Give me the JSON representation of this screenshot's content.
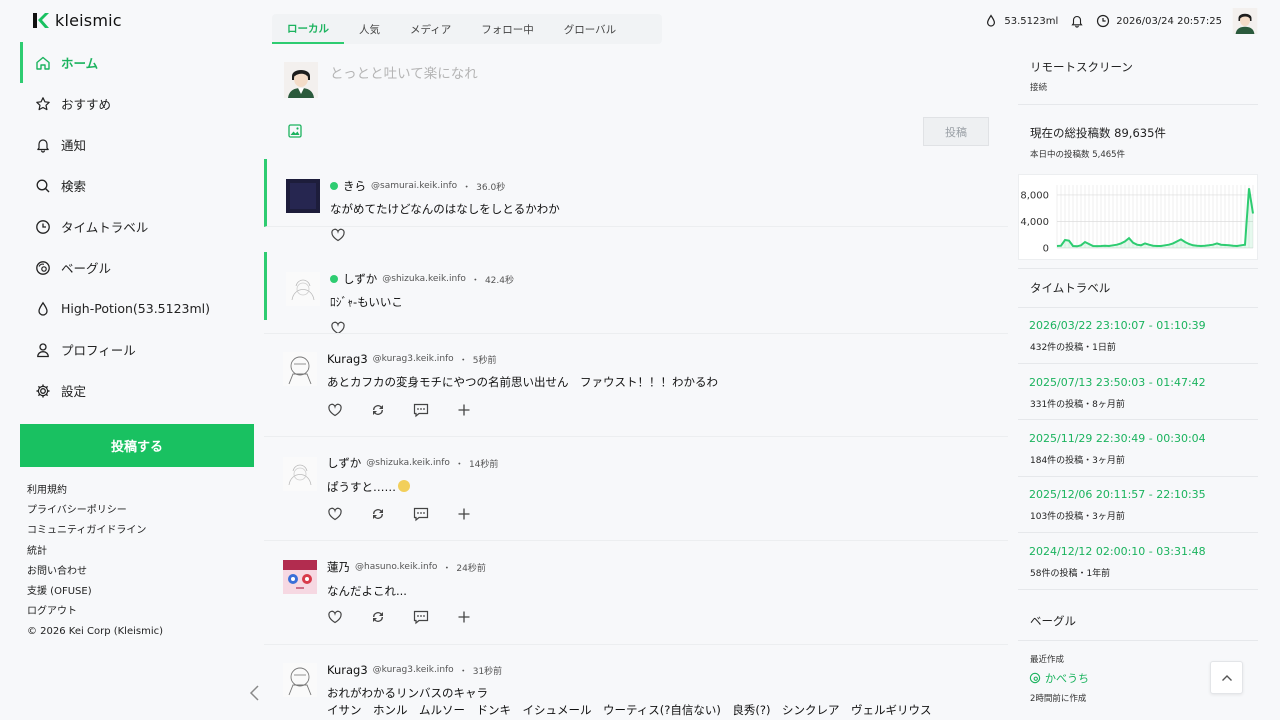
{
  "brand": {
    "name": "kleismic",
    "accent": "#19c161"
  },
  "nav": {
    "items": [
      {
        "label": "ホーム",
        "icon": "home-icon",
        "active": true
      },
      {
        "label": "おすすめ",
        "icon": "star-icon"
      },
      {
        "label": "通知",
        "icon": "bell-icon"
      },
      {
        "label": "検索",
        "icon": "search-icon"
      },
      {
        "label": "タイムトラベル",
        "icon": "clock-icon"
      },
      {
        "label": "ベーグル",
        "icon": "bagel-icon"
      },
      {
        "label": "High-Potion(53.5123ml)",
        "icon": "drop-icon"
      },
      {
        "label": "プロフィール",
        "icon": "user-icon"
      },
      {
        "label": "設定",
        "icon": "gear-icon"
      }
    ],
    "post_button": "投稿する"
  },
  "footer_links": [
    "利用規約",
    "プライバシーポリシー",
    "コミュニティガイドライン",
    "統計",
    "お問い合わせ",
    "支援 (OFUSE)",
    "ログアウト",
    "© 2026 Kei Corp (Kleismic)"
  ],
  "tabs": [
    "ローカル",
    "人気",
    "メディア",
    "フォロー中",
    "グローバル"
  ],
  "compose": {
    "placeholder": "とっとと吐いて楽になれ",
    "submit": "投稿"
  },
  "posts": [
    {
      "name": "きら",
      "handle": "@samurai.keik.info",
      "time": "36.0秒",
      "body": "ながめてたけどなんのはなしをしとるかわか",
      "online": true
    },
    {
      "name": "しずか",
      "handle": "@shizuka.keik.info",
      "time": "42.4秒",
      "body": "ﾛｼﾞｬ-もいいこ",
      "online": true
    },
    {
      "name": "Kurag3",
      "handle": "@kurag3.keik.info",
      "time": "5秒前",
      "body": "あとカフカの変身モチにやつの名前思い出せん　ファウスト！！！わかるわ"
    },
    {
      "name": "しずか",
      "handle": "@shizuka.keik.info",
      "time": "14秒前",
      "body": "ぱうすと……"
    },
    {
      "name": "蓮乃",
      "handle": "@hasuno.keik.info",
      "time": "24秒前",
      "body": "なんだよこれ..."
    },
    {
      "name": "Kurag3",
      "handle": "@kurag3.keik.info",
      "time": "31秒前",
      "body": "おれがわかるリンバスのキャラ",
      "body2": "イサン　ホンル　ムルソー　ドンキ　イシュメール　ウーティス(?自信ない)　良秀(?)　シンクレア　ヴェルギリウス"
    }
  ],
  "topbar": {
    "potion": "53.5123ml",
    "datetime": "2026/03/24 20:57:25"
  },
  "remote": {
    "title": "リモートスクリーン",
    "status": "接続"
  },
  "stats": {
    "title": "現在の総投稿数 89,635件",
    "sub": "本日中の投稿数 5,465件",
    "y_ticks": [
      "8,000",
      "4,000",
      "0"
    ]
  },
  "chart_data": {
    "type": "area",
    "title": "",
    "ylim": [
      0,
      9500
    ],
    "y_ticks": [
      0,
      4000,
      8000
    ],
    "values": [
      300,
      350,
      1200,
      1100,
      300,
      250,
      400,
      900,
      600,
      300,
      280,
      300,
      350,
      300,
      400,
      500,
      700,
      1000,
      1500,
      800,
      500,
      400,
      700,
      500,
      350,
      300,
      300,
      400,
      500,
      700,
      1000,
      1300,
      900,
      600,
      400,
      350,
      300,
      350,
      400,
      500,
      700,
      500,
      450,
      400,
      350,
      300,
      400,
      500,
      9000,
      5200
    ]
  },
  "timetravel": {
    "title": "タイムトラベル",
    "items": [
      {
        "range": "2026/03/22 23:10:07 - 01:10:39",
        "sub": "432件の投稿・1日前"
      },
      {
        "range": "2025/07/13 23:50:03 - 01:47:42",
        "sub": "331件の投稿・8ヶ月前"
      },
      {
        "range": "2025/11/29 22:30:49 - 00:30:04",
        "sub": "184件の投稿・3ヶ月前"
      },
      {
        "range": "2025/12/06 20:11:57 - 22:10:35",
        "sub": "103件の投稿・3ヶ月前"
      },
      {
        "range": "2024/12/12 02:00:10 - 03:31:48",
        "sub": "58件の投稿・1年前"
      }
    ]
  },
  "bagel": {
    "title": "ベーグル",
    "recent_label": "最近作成",
    "name": "かべうち",
    "created": "2時間前に作成"
  }
}
